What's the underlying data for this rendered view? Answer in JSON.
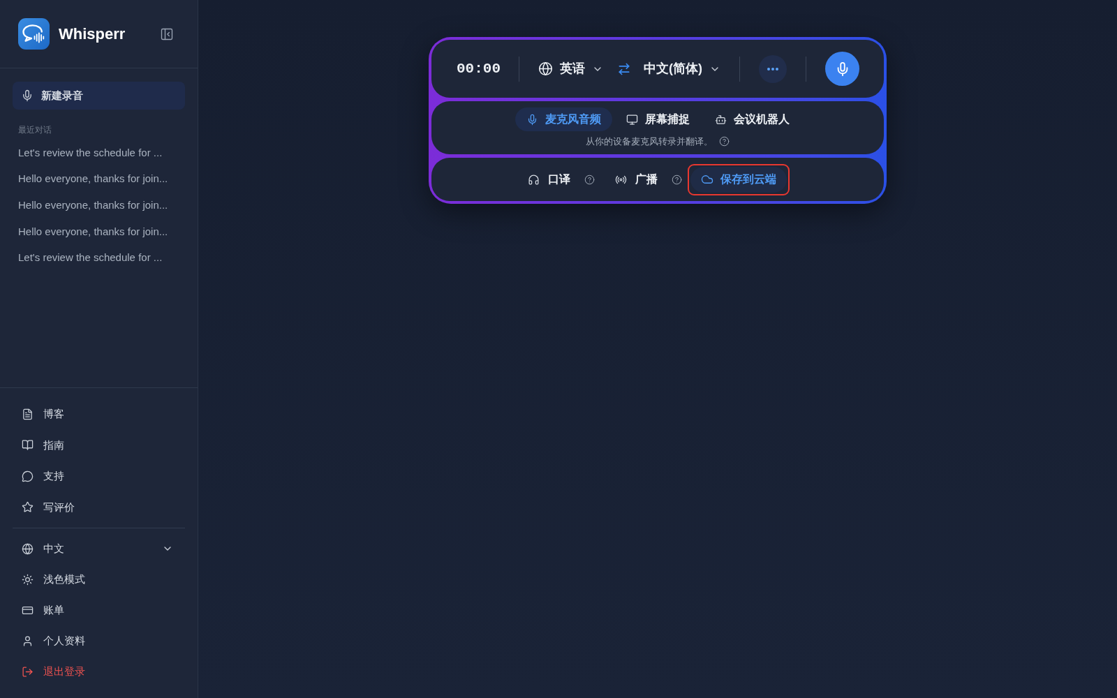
{
  "sidebar": {
    "brand": "Whisperr",
    "new_recording": "新建录音",
    "recent_heading": "最近对话",
    "recent": [
      "Let's review the schedule for ...",
      "Hello everyone, thanks for join...",
      "Hello everyone, thanks for join...",
      "Hello everyone, thanks for join...",
      "Let's review the schedule for ..."
    ],
    "nav": [
      {
        "label": "博客"
      },
      {
        "label": "指南"
      },
      {
        "label": "支持"
      },
      {
        "label": "写评价"
      }
    ],
    "menu": [
      {
        "kind": "dropdown",
        "label": "中文",
        "expanded": false
      },
      {
        "kind": "link",
        "label": "浅色模式"
      },
      {
        "kind": "link",
        "label": "账单"
      },
      {
        "kind": "link",
        "label": "个人资料"
      },
      {
        "kind": "danger",
        "label": "退出登录"
      }
    ]
  },
  "recorder": {
    "timer": "00:00",
    "source_language": "英语",
    "target_language": "中文(简体)",
    "input_tabs": [
      {
        "label": "麦克风音频",
        "selected": true
      },
      {
        "label": "屏幕捕捉",
        "selected": false
      },
      {
        "label": "会议机器人",
        "selected": false
      }
    ],
    "input_description": "从你的设备麦克风转录并翻译。",
    "options": [
      {
        "label": "口译"
      },
      {
        "label": "广播"
      }
    ],
    "save_button": {
      "label": "保存到云端",
      "highlighted": true
    }
  }
}
